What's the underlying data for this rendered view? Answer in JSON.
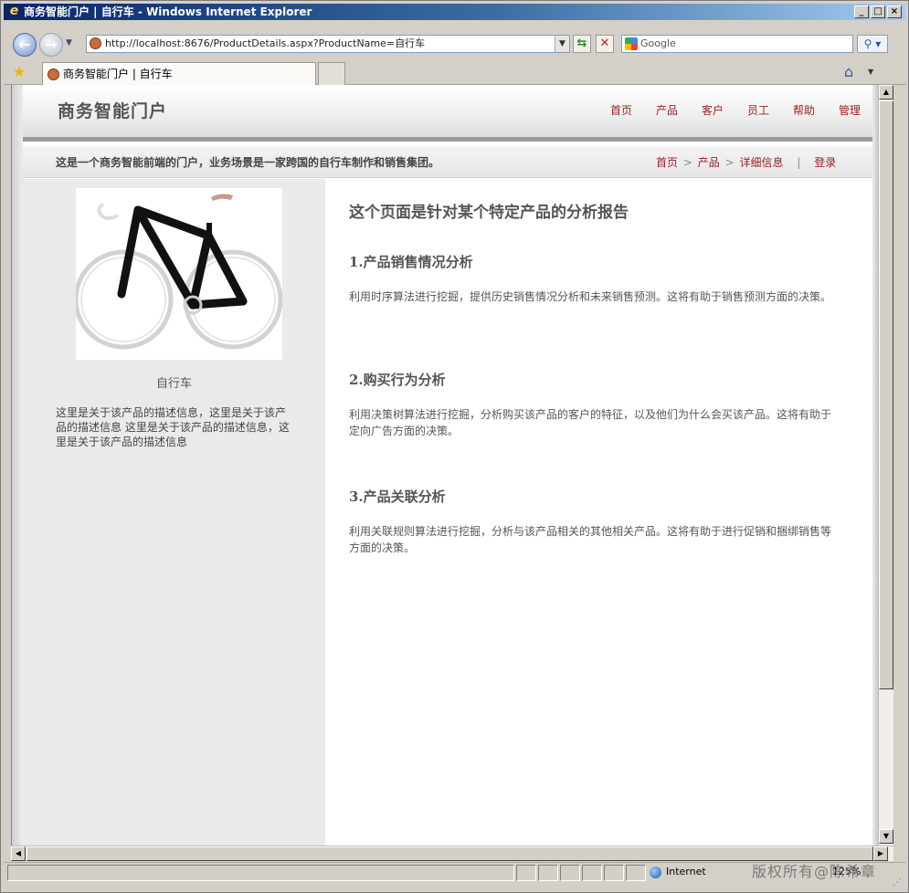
{
  "browser": {
    "window_title": "商务智能门户 | 自行车 - Windows Internet Explorer",
    "window_buttons": [
      "_",
      "□",
      "×"
    ],
    "address": "http://localhost:8676/ProductDetails.aspx?ProductName=自行车",
    "search_placeholder": "Google",
    "tab_title": "商务智能门户 | 自行车",
    "status_zone": "Internet",
    "zoom": "125%"
  },
  "site": {
    "title": "商务智能门户",
    "nav": [
      "首页",
      "产品",
      "客户",
      "员工",
      "帮助",
      "管理"
    ],
    "tagline": "这是一个商务智能前端的门户，业务场景是一家跨国的自行车制作和销售集团。",
    "breadcrumb": [
      "首页",
      "产品",
      "详细信息"
    ],
    "breadcrumb_sep": ">",
    "login": "登录",
    "divider": "|"
  },
  "product": {
    "name": "自行车",
    "description": "这里是关于该产品的描述信息，这里是关于该产品的描述信息 这里是关于该产品的描述信息，这里是关于该产品的描述信息"
  },
  "report": {
    "heading": "这个页面是针对某个特定产品的分析报告",
    "sections": [
      {
        "title": "1.产品销售情况分析",
        "body": "利用时序算法进行挖掘，提供历史销售情况分析和未来销售预测。这将有助于销售预测方面的决策。"
      },
      {
        "title": "2.购买行为分析",
        "body": "利用决策树算法进行挖掘，分析购买该产品的客户的特征，以及他们为什么会买该产品。这将有助于定向广告方面的决策。"
      },
      {
        "title": "3.产品关联分析",
        "body": "利用关联规则算法进行挖掘，分析与该产品相关的其他相关产品。这将有助于进行促销和捆绑销售等方面的决策。"
      }
    ]
  },
  "watermark": "版权所有@陈希章",
  "colors": {
    "link": "#9b2020",
    "sidebar_bg": "#eaeaea"
  }
}
